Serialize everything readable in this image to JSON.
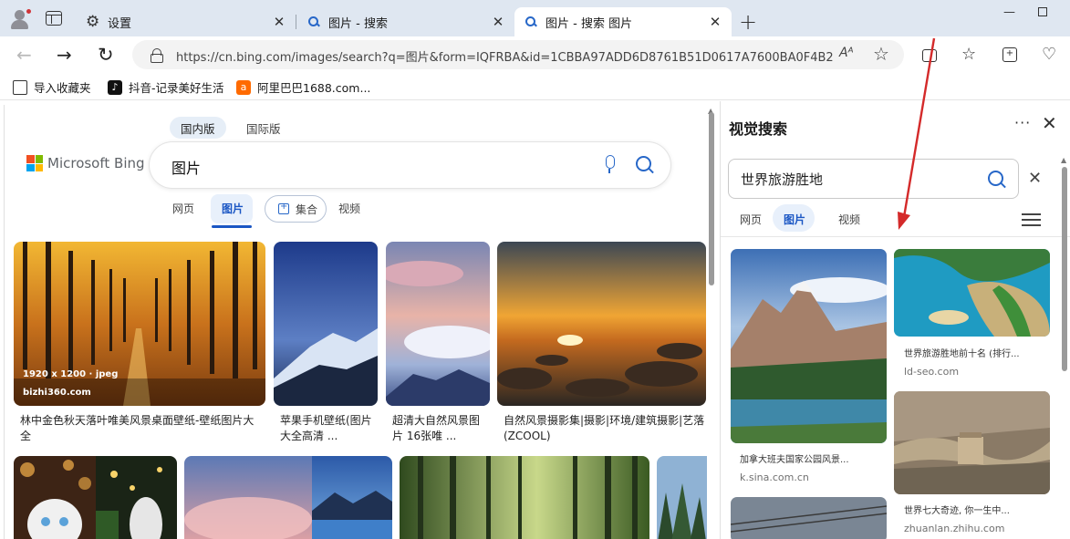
{
  "tabs": [
    {
      "title": "设置",
      "icon": "gear-icon"
    },
    {
      "title": "图片 - 搜索",
      "icon": "bing-search-icon"
    },
    {
      "title": "图片 - 搜索 图片",
      "icon": "bing-search-icon",
      "active": true
    }
  ],
  "toolbar": {
    "url": "https://cn.bing.com/images/search?q=图片&form=IQFRBA&id=1CBBA97ADD6D8761B51D0617A7600BA0F4B2A5...",
    "read_aloud": "Aᴬ"
  },
  "favorites": [
    {
      "label": "导入收藏夹",
      "icon": "import-icon"
    },
    {
      "label": "抖音-记录美好生活",
      "icon": "douyin-icon"
    },
    {
      "label": "阿里巴巴1688.com...",
      "icon": "alibaba-icon"
    }
  ],
  "bing": {
    "region_tabs": [
      "国内版",
      "国际版"
    ],
    "logo_text": "Microsoft Bing",
    "query": "图片",
    "scopes": {
      "web": "网页",
      "images": "图片",
      "collections": "集合",
      "videos": "视频"
    }
  },
  "results": [
    {
      "caption": "林中金色秋天落叶唯美风景桌面壁纸-壁纸图片大全",
      "meta_size": "1920 x 1200 · jpeg",
      "meta_source": "bizhi360.com"
    },
    {
      "caption": "苹果手机壁纸(图片大全高清 ..."
    },
    {
      "caption": "超清大自然风景图片 16张唯 ..."
    },
    {
      "caption": "自然风景摄影集|摄影|环境/建筑摄影|艺落(ZCOOL)"
    }
  ],
  "visual_search": {
    "title": "视觉搜索",
    "query": "世界旅游胜地",
    "tabs": {
      "web": "网页",
      "images": "图片",
      "videos": "视频"
    },
    "items": [
      {
        "caption": "加拿大班夫国家公园风景...",
        "source": "k.sina.com.cn"
      },
      {
        "caption": "世界旅游胜地前十名 (排行...",
        "source": "ld-seo.com"
      },
      {
        "caption": "世界七大奇迹, 你一生中...",
        "source": "zhuanlan.zhihu.com"
      }
    ]
  },
  "colors": {
    "accent": "#1a56c4",
    "annotation": "#d42a2a"
  }
}
